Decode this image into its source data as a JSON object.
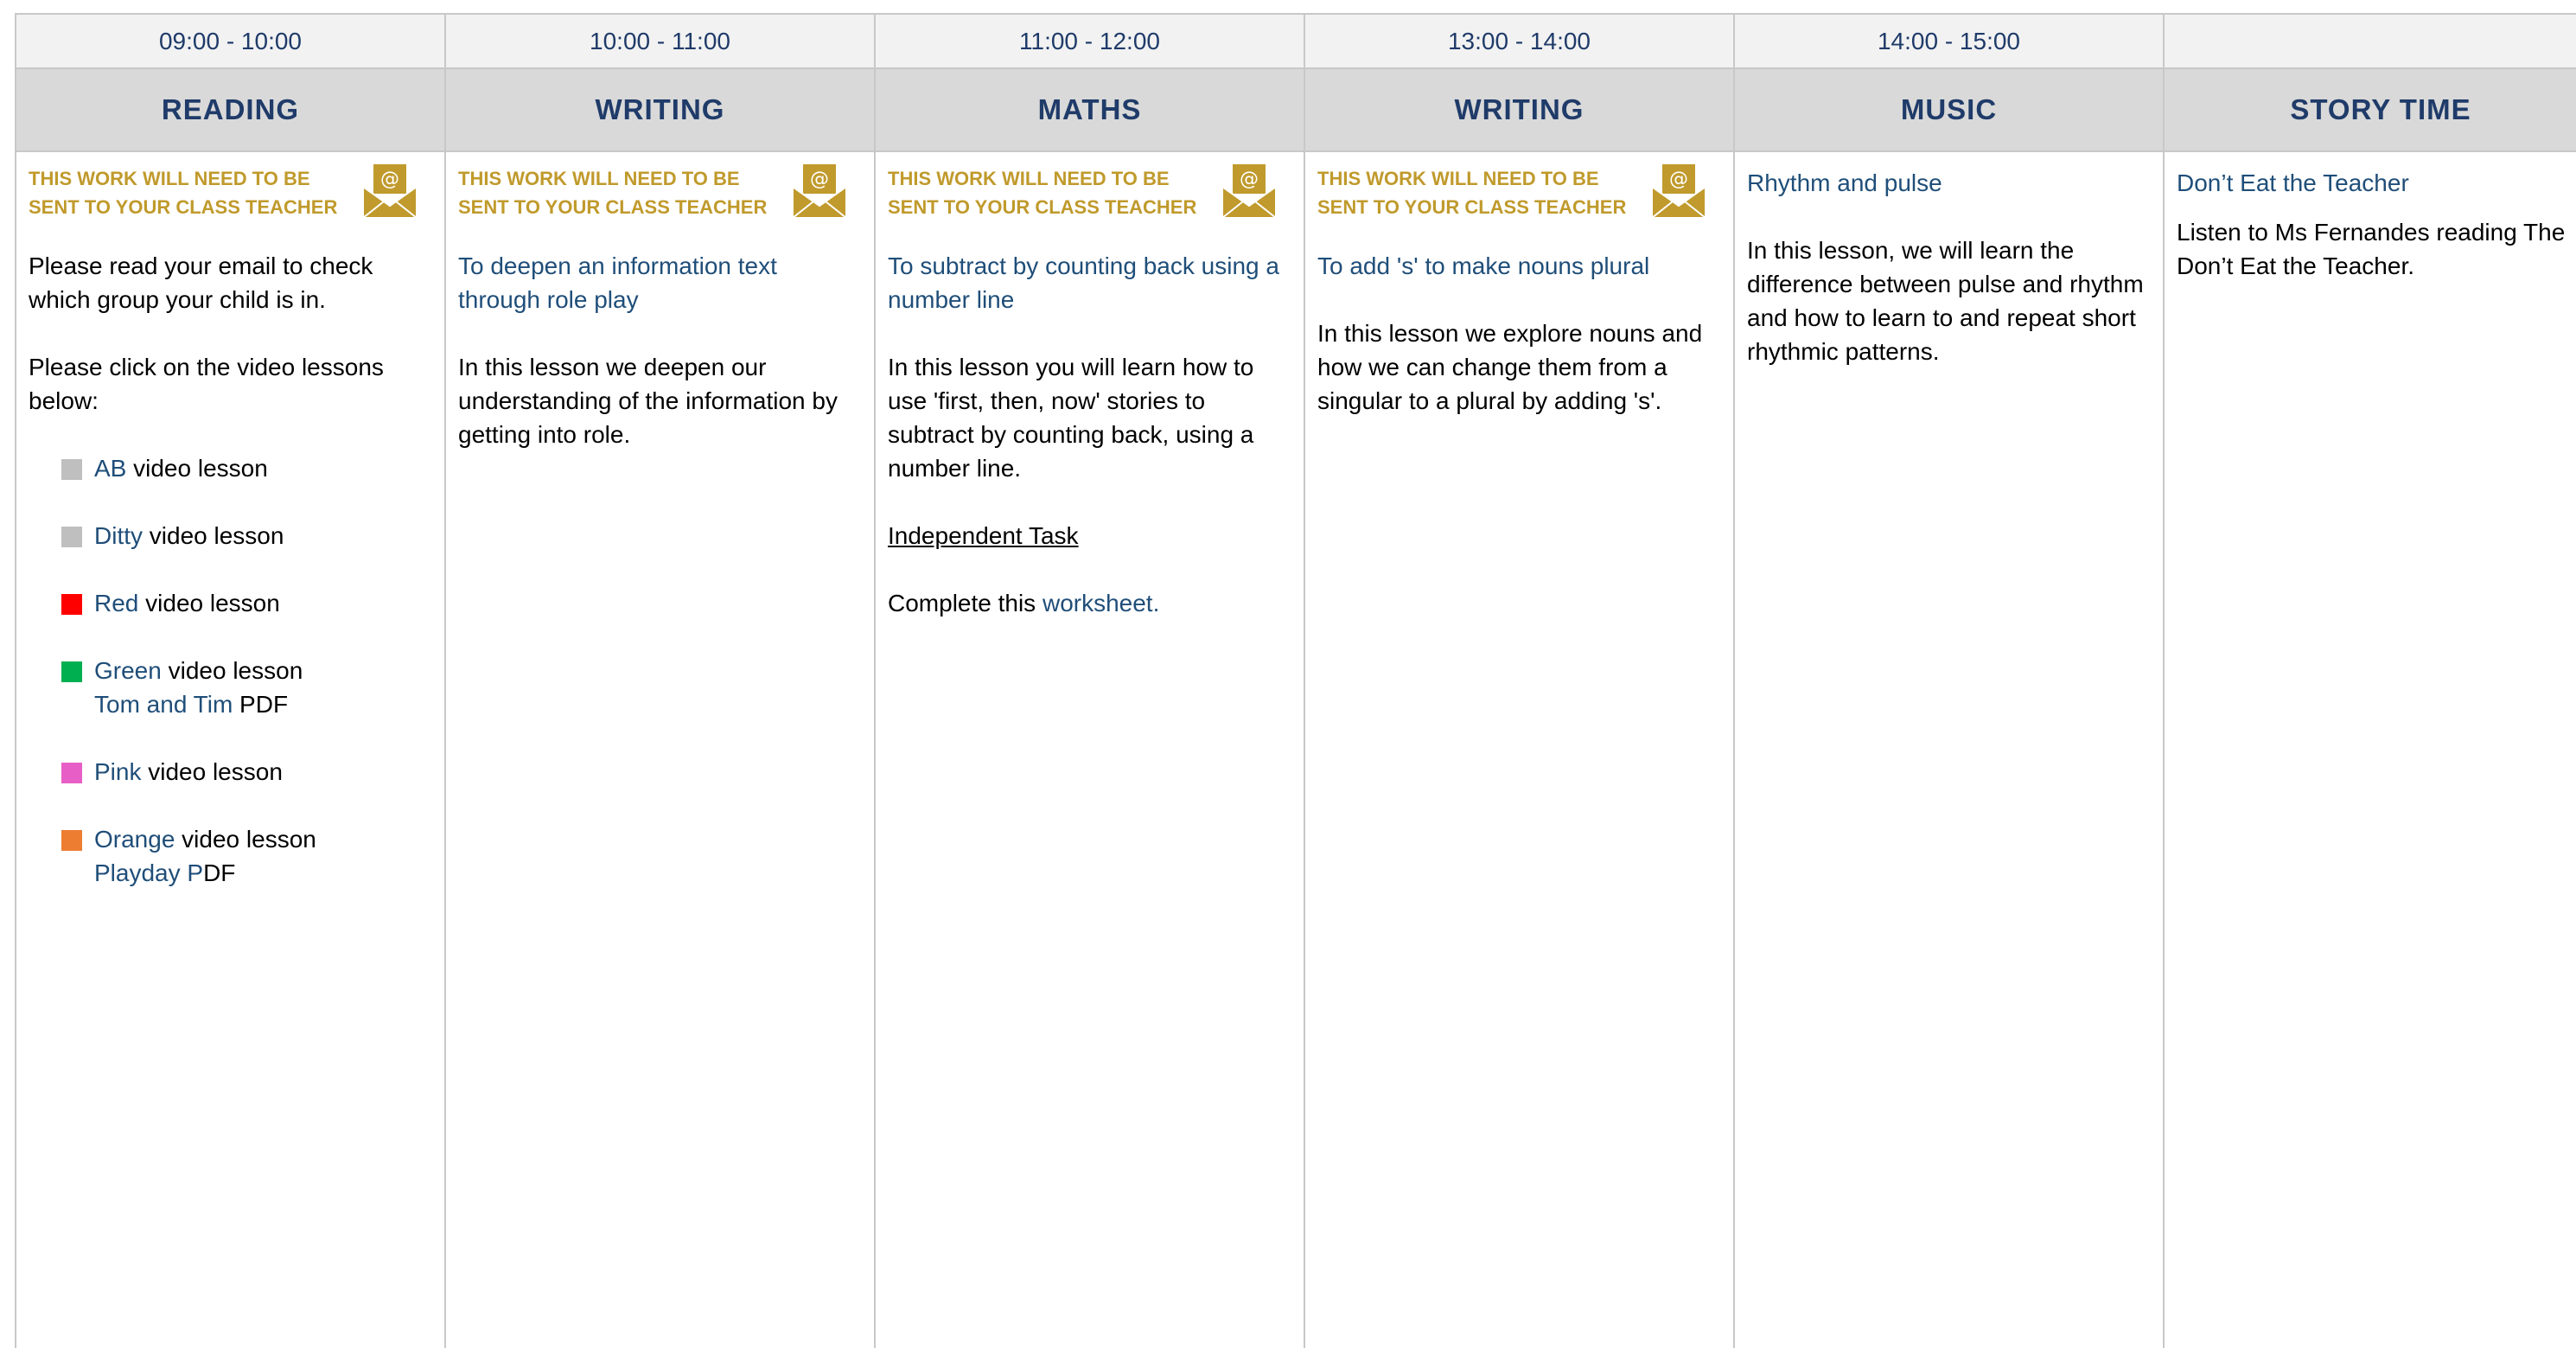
{
  "colors": {
    "header_text": "#1f3b69",
    "link_text": "#1f4e79",
    "notice_text": "#c09a2c",
    "time_row_bg": "#f2f2f2",
    "subject_row_bg": "#d9d9d9",
    "border": "#c8c8c8"
  },
  "notice": {
    "line1": "THIS WORK WILL NEED TO BE",
    "line2": "SENT TO YOUR CLASS TEACHER",
    "icon": "envelope-at-icon"
  },
  "columns": [
    {
      "time": "09:00 - 10:00",
      "subject": "READING",
      "intro": "Please read your email to check which group your child is in.",
      "instruction": "Please click on the video lessons below:",
      "groups": [
        {
          "link": "AB",
          "text": " video lesson",
          "color": "#bfbfbf"
        },
        {
          "link": "Ditty",
          "text": " video lesson",
          "color": "#bfbfbf"
        },
        {
          "link": "Red",
          "text": " video lesson",
          "color": "#ff0000"
        },
        {
          "link": "Green",
          "text": " video lesson",
          "color": "#00b050",
          "extra_link": "Tom and Tim",
          "extra_text": " PDF"
        },
        {
          "link": "Pink",
          "text": " video lesson",
          "color": "#e75fc6"
        },
        {
          "link": "Orange",
          "text": " video lesson",
          "color": "#ed7d31",
          "extra_link": "Playday P",
          "extra_text": "DF"
        }
      ]
    },
    {
      "time": "10:00 - 11:00",
      "subject": "WRITING",
      "objective": "To deepen an information text through role play",
      "description": "In this lesson we deepen our understanding of the information by getting into role."
    },
    {
      "time": "11:00 - 12:00",
      "subject": "MATHS",
      "objective": "To subtract by counting back using a number line",
      "description": "In this lesson you will learn how to use 'first, then, now' stories to subtract by counting back, using a number line.",
      "task_heading": "Independent Task",
      "task_text": "Complete this ",
      "task_link": "worksheet."
    },
    {
      "time": "13:00 - 14:00",
      "subject": "WRITING",
      "objective": "To add 's' to make nouns plural",
      "description": "In this lesson we explore nouns and how we can change them from a singular to a plural by adding 's'."
    },
    {
      "time": "14:00 - 15:00",
      "subject": "MUSIC",
      "objective": "Rhythm and pulse",
      "description": "In this lesson, we will learn the difference between pulse and rhythm and how to learn to and repeat short rhythmic patterns."
    },
    {
      "time": "",
      "subject": "STORY TIME",
      "objective": "Don’t Eat the Teacher",
      "description_line1": "Listen to Ms Fernandes reading The",
      "description_line2": "Don’t Eat the Teacher."
    }
  ]
}
